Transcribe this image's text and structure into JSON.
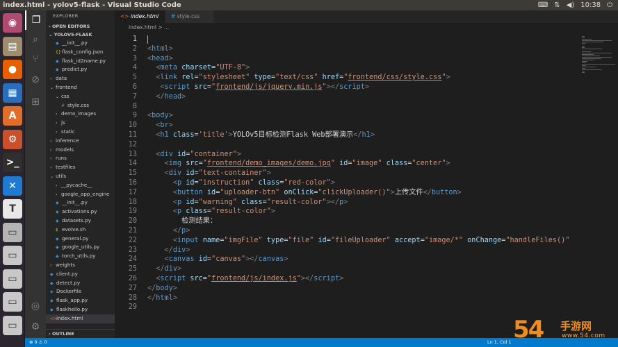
{
  "window": {
    "title": "index.html - yolov5-flask - Visual Studio Code",
    "clock": "10:38"
  },
  "launcher": {
    "items": [
      {
        "name": "ubuntu-icon",
        "color": "#b04a6e",
        "glyph": "◉"
      },
      {
        "name": "files-icon",
        "color": "#a08c6e",
        "glyph": "▤"
      },
      {
        "name": "firefox-icon",
        "color": "#e66000",
        "glyph": "●"
      },
      {
        "name": "writer-icon",
        "color": "#2a6ebb",
        "glyph": "▦"
      },
      {
        "name": "software-center-icon",
        "color": "#e06d28",
        "glyph": "A"
      },
      {
        "name": "settings-icon",
        "color": "#c8502d",
        "glyph": "⚙"
      },
      {
        "name": "terminal-icon",
        "color": "#2f2f2f",
        "glyph": ">_"
      },
      {
        "name": "vscode-icon",
        "color": "#1f7bd1",
        "glyph": "✕"
      },
      {
        "name": "typora-icon",
        "color": "#e8e8e8",
        "glyph": "T"
      },
      {
        "name": "drive-icon",
        "color": "#b4b4b4",
        "glyph": "▭"
      },
      {
        "name": "drive-icon-2",
        "color": "#c8c8c8",
        "glyph": "▭"
      },
      {
        "name": "drive-icon-3",
        "color": "#c8c8c8",
        "glyph": "▭"
      },
      {
        "name": "drive-icon-4",
        "color": "#c8c8c8",
        "glyph": "▭"
      },
      {
        "name": "drive-icon-5",
        "color": "#c8c8c8",
        "glyph": "▭"
      }
    ]
  },
  "explorer": {
    "header": "EXPLORER",
    "open_editors": "OPEN EDITORS",
    "root": "YOLOV5-FLASK",
    "outline": "OUTLINE",
    "items": [
      {
        "label": "__init__.py",
        "depth": 1,
        "kind": "py"
      },
      {
        "label": "flask_config.json",
        "depth": 1,
        "kind": "json"
      },
      {
        "label": "flask_id2name.py",
        "depth": 1,
        "kind": "py"
      },
      {
        "label": "predict.py",
        "depth": 1,
        "kind": "py"
      },
      {
        "label": "data",
        "depth": 0,
        "kind": "folder"
      },
      {
        "label": "frontend",
        "depth": 0,
        "kind": "folder-open"
      },
      {
        "label": "css",
        "depth": 1,
        "kind": "folder-open"
      },
      {
        "label": "style.css",
        "depth": 2,
        "kind": "css"
      },
      {
        "label": "demo_images",
        "depth": 1,
        "kind": "folder"
      },
      {
        "label": "js",
        "depth": 1,
        "kind": "folder"
      },
      {
        "label": "static",
        "depth": 1,
        "kind": "folder"
      },
      {
        "label": "inference",
        "depth": 0,
        "kind": "folder"
      },
      {
        "label": "models",
        "depth": 0,
        "kind": "folder"
      },
      {
        "label": "runs",
        "depth": 0,
        "kind": "folder"
      },
      {
        "label": "testfiles",
        "depth": 0,
        "kind": "folder"
      },
      {
        "label": "utils",
        "depth": 0,
        "kind": "folder-open"
      },
      {
        "label": "__pycache__",
        "depth": 1,
        "kind": "folder"
      },
      {
        "label": "google_app_engine",
        "depth": 1,
        "kind": "folder"
      },
      {
        "label": "__init__.py",
        "depth": 1,
        "kind": "py"
      },
      {
        "label": "activations.py",
        "depth": 1,
        "kind": "py"
      },
      {
        "label": "datasets.py",
        "depth": 1,
        "kind": "py"
      },
      {
        "label": "evolve.sh",
        "depth": 1,
        "kind": "sh"
      },
      {
        "label": "general.py",
        "depth": 1,
        "kind": "py"
      },
      {
        "label": "google_utils.py",
        "depth": 1,
        "kind": "py"
      },
      {
        "label": "torch_utils.py",
        "depth": 1,
        "kind": "py"
      },
      {
        "label": "weights",
        "depth": 0,
        "kind": "folder"
      },
      {
        "label": "client.py",
        "depth": 0,
        "kind": "py"
      },
      {
        "label": "detect.py",
        "depth": 0,
        "kind": "py"
      },
      {
        "label": "Dockerfile",
        "depth": 0,
        "kind": "docker"
      },
      {
        "label": "flask_app.py",
        "depth": 0,
        "kind": "py"
      },
      {
        "label": "flaskhello.py",
        "depth": 0,
        "kind": "py"
      },
      {
        "label": "index.html",
        "depth": 0,
        "kind": "html",
        "active": true
      }
    ]
  },
  "tabs": [
    {
      "label": "index.html",
      "icon": "<>",
      "active": true,
      "close": "✕"
    },
    {
      "label": "style.css",
      "icon": "#",
      "active": false
    }
  ],
  "breadcrumb": "index.html > ...",
  "editor": {
    "lines": [
      [],
      [
        [
          "ang",
          "<"
        ],
        [
          "tag",
          "html"
        ],
        [
          "ang",
          ">"
        ]
      ],
      [
        [
          "ang",
          "<"
        ],
        [
          "tag",
          "head"
        ],
        [
          "ang",
          ">"
        ]
      ],
      [
        [
          "t",
          "  "
        ],
        [
          "ang",
          "<"
        ],
        [
          "tag",
          "meta"
        ],
        [
          "t",
          " "
        ],
        [
          "attr",
          "charset"
        ],
        [
          "t",
          "="
        ],
        [
          "str",
          "\"UTF-8\""
        ],
        [
          "ang",
          ">"
        ]
      ],
      [
        [
          "t",
          "  "
        ],
        [
          "ang",
          "<"
        ],
        [
          "tag",
          "link"
        ],
        [
          "t",
          " "
        ],
        [
          "attr",
          "rel"
        ],
        [
          "t",
          "="
        ],
        [
          "str",
          "\"stylesheet\""
        ],
        [
          "t",
          " "
        ],
        [
          "attr",
          "type"
        ],
        [
          "t",
          "="
        ],
        [
          "str",
          "\"text/css\""
        ],
        [
          "t",
          " "
        ],
        [
          "attr",
          "href"
        ],
        [
          "t",
          "="
        ],
        [
          "str",
          "\""
        ],
        [
          "url",
          "frontend/css/style.css"
        ],
        [
          "str",
          "\""
        ],
        [
          "ang",
          ">"
        ]
      ],
      [
        [
          "t",
          "   "
        ],
        [
          "ang",
          "<"
        ],
        [
          "tag",
          "script"
        ],
        [
          "t",
          " "
        ],
        [
          "attr",
          "src"
        ],
        [
          "t",
          "="
        ],
        [
          "str",
          "\""
        ],
        [
          "url",
          "frontend/js/jquery.min.js"
        ],
        [
          "str",
          "\""
        ],
        [
          "ang",
          "></"
        ],
        [
          "tag",
          "script"
        ],
        [
          "ang",
          ">"
        ]
      ],
      [
        [
          "t",
          "  "
        ],
        [
          "ang",
          "</"
        ],
        [
          "tag",
          "head"
        ],
        [
          "ang",
          ">"
        ]
      ],
      [],
      [
        [
          "ang",
          "<"
        ],
        [
          "tag",
          "body"
        ],
        [
          "ang",
          ">"
        ]
      ],
      [
        [
          "t",
          "  "
        ],
        [
          "ang",
          "<"
        ],
        [
          "tag",
          "br"
        ],
        [
          "ang",
          ">"
        ]
      ],
      [
        [
          "t",
          "  "
        ],
        [
          "ang",
          "<"
        ],
        [
          "tag",
          "h1"
        ],
        [
          "t",
          " "
        ],
        [
          "attr",
          "class"
        ],
        [
          "t",
          "="
        ],
        [
          "str",
          "'title'"
        ],
        [
          "ang",
          ">"
        ],
        [
          "t",
          "YOLOv5目标检测Flask Web部署演示"
        ],
        [
          "ang",
          "</"
        ],
        [
          "tag",
          "h1"
        ],
        [
          "ang",
          ">"
        ]
      ],
      [],
      [
        [
          "t",
          "  "
        ],
        [
          "ang",
          "<"
        ],
        [
          "tag",
          "div"
        ],
        [
          "t",
          " "
        ],
        [
          "attr",
          "id"
        ],
        [
          "t",
          "="
        ],
        [
          "str",
          "\"container\""
        ],
        [
          "ang",
          ">"
        ]
      ],
      [
        [
          "t",
          "    "
        ],
        [
          "ang",
          "<"
        ],
        [
          "tag",
          "img"
        ],
        [
          "t",
          " "
        ],
        [
          "attr",
          "src"
        ],
        [
          "t",
          "="
        ],
        [
          "str",
          "\""
        ],
        [
          "url",
          "frontend/demo_images/demo.jpg"
        ],
        [
          "str",
          "\""
        ],
        [
          "t",
          " "
        ],
        [
          "attr",
          "id"
        ],
        [
          "t",
          "="
        ],
        [
          "str",
          "\"image\""
        ],
        [
          "t",
          " "
        ],
        [
          "attr",
          "class"
        ],
        [
          "t",
          "="
        ],
        [
          "str",
          "\"center\""
        ],
        [
          "ang",
          ">"
        ]
      ],
      [
        [
          "t",
          "    "
        ],
        [
          "ang",
          "<"
        ],
        [
          "tag",
          "div"
        ],
        [
          "t",
          " "
        ],
        [
          "attr",
          "id"
        ],
        [
          "t",
          "="
        ],
        [
          "str",
          "\"text-container\""
        ],
        [
          "ang",
          ">"
        ]
      ],
      [
        [
          "t",
          "      "
        ],
        [
          "ang",
          "<"
        ],
        [
          "tag",
          "p"
        ],
        [
          "t",
          " "
        ],
        [
          "attr",
          "id"
        ],
        [
          "t",
          "="
        ],
        [
          "str",
          "\"instruction\""
        ],
        [
          "t",
          " "
        ],
        [
          "attr",
          "class"
        ],
        [
          "t",
          "="
        ],
        [
          "str",
          "\"red-color\""
        ],
        [
          "ang",
          ">"
        ]
      ],
      [
        [
          "t",
          "      "
        ],
        [
          "ang",
          "<"
        ],
        [
          "tag",
          "button"
        ],
        [
          "t",
          " "
        ],
        [
          "attr",
          "id"
        ],
        [
          "t",
          "="
        ],
        [
          "str",
          "\"uploader-btn\""
        ],
        [
          "t",
          " "
        ],
        [
          "attr",
          "onClick"
        ],
        [
          "t",
          "="
        ],
        [
          "str",
          "\"clickUploader()\""
        ],
        [
          "ang",
          ">"
        ],
        [
          "t",
          "上传文件"
        ],
        [
          "ang",
          "</"
        ],
        [
          "tag",
          "button"
        ],
        [
          "ang",
          ">"
        ]
      ],
      [
        [
          "t",
          "      "
        ],
        [
          "ang",
          "<"
        ],
        [
          "tag",
          "p"
        ],
        [
          "t",
          " "
        ],
        [
          "attr",
          "id"
        ],
        [
          "t",
          "="
        ],
        [
          "str",
          "\"warning\""
        ],
        [
          "t",
          " "
        ],
        [
          "attr",
          "class"
        ],
        [
          "t",
          "="
        ],
        [
          "str",
          "\"result-color\""
        ],
        [
          "ang",
          "></"
        ],
        [
          "tag",
          "p"
        ],
        [
          "ang",
          ">"
        ]
      ],
      [
        [
          "t",
          "      "
        ],
        [
          "ang",
          "<"
        ],
        [
          "tag",
          "p"
        ],
        [
          "t",
          " "
        ],
        [
          "attr",
          "class"
        ],
        [
          "t",
          "="
        ],
        [
          "str",
          "\"result-color\""
        ],
        [
          "ang",
          ">"
        ]
      ],
      [
        [
          "t",
          "        检测结果："
        ]
      ],
      [
        [
          "t",
          "      "
        ],
        [
          "ang",
          "</"
        ],
        [
          "tag",
          "p"
        ],
        [
          "ang",
          ">"
        ]
      ],
      [
        [
          "t",
          "      "
        ],
        [
          "ang",
          "<"
        ],
        [
          "tag",
          "input"
        ],
        [
          "t",
          " "
        ],
        [
          "attr",
          "name"
        ],
        [
          "t",
          "="
        ],
        [
          "str",
          "\"imgFile\""
        ],
        [
          "t",
          " "
        ],
        [
          "attr",
          "type"
        ],
        [
          "t",
          "="
        ],
        [
          "str",
          "\"file\""
        ],
        [
          "t",
          " "
        ],
        [
          "attr",
          "id"
        ],
        [
          "t",
          "="
        ],
        [
          "str",
          "\"fileUploader\""
        ],
        [
          "t",
          " "
        ],
        [
          "attr",
          "accept"
        ],
        [
          "t",
          "="
        ],
        [
          "str",
          "\"image/*\""
        ],
        [
          "t",
          " "
        ],
        [
          "attr",
          "onChange"
        ],
        [
          "t",
          "="
        ],
        [
          "str",
          "\"handleFiles()\""
        ]
      ],
      [
        [
          "t",
          "    "
        ],
        [
          "ang",
          "</"
        ],
        [
          "tag",
          "div"
        ],
        [
          "ang",
          ">"
        ]
      ],
      [
        [
          "t",
          "    "
        ],
        [
          "ang",
          "<"
        ],
        [
          "tag",
          "canvas"
        ],
        [
          "t",
          " "
        ],
        [
          "attr",
          "id"
        ],
        [
          "t",
          "="
        ],
        [
          "str",
          "\"canvas\""
        ],
        [
          "ang",
          "></"
        ],
        [
          "tag",
          "canvas"
        ],
        [
          "ang",
          ">"
        ]
      ],
      [
        [
          "t",
          "  "
        ],
        [
          "ang",
          "</"
        ],
        [
          "tag",
          "div"
        ],
        [
          "ang",
          ">"
        ]
      ],
      [
        [
          "t",
          "  "
        ],
        [
          "ang",
          "<"
        ],
        [
          "tag",
          "script"
        ],
        [
          "t",
          " "
        ],
        [
          "attr",
          "src"
        ],
        [
          "t",
          "="
        ],
        [
          "str",
          "\""
        ],
        [
          "url",
          "frontend/js/index.js"
        ],
        [
          "str",
          "\""
        ],
        [
          "ang",
          "></"
        ],
        [
          "tag",
          "script"
        ],
        [
          "ang",
          ">"
        ]
      ],
      [
        [
          "ang",
          "</"
        ],
        [
          "tag",
          "body"
        ],
        [
          "ang",
          ">"
        ]
      ],
      [
        [
          "ang",
          "</"
        ],
        [
          "tag",
          "html"
        ],
        [
          "ang",
          ">"
        ]
      ],
      []
    ]
  },
  "status": {
    "left": "⊗ 0  ⚠ 0",
    "position": "Ln 1, Col 1"
  },
  "watermark": {
    "big": "54",
    "cn": "手游网",
    "domain": "www.54.com"
  }
}
